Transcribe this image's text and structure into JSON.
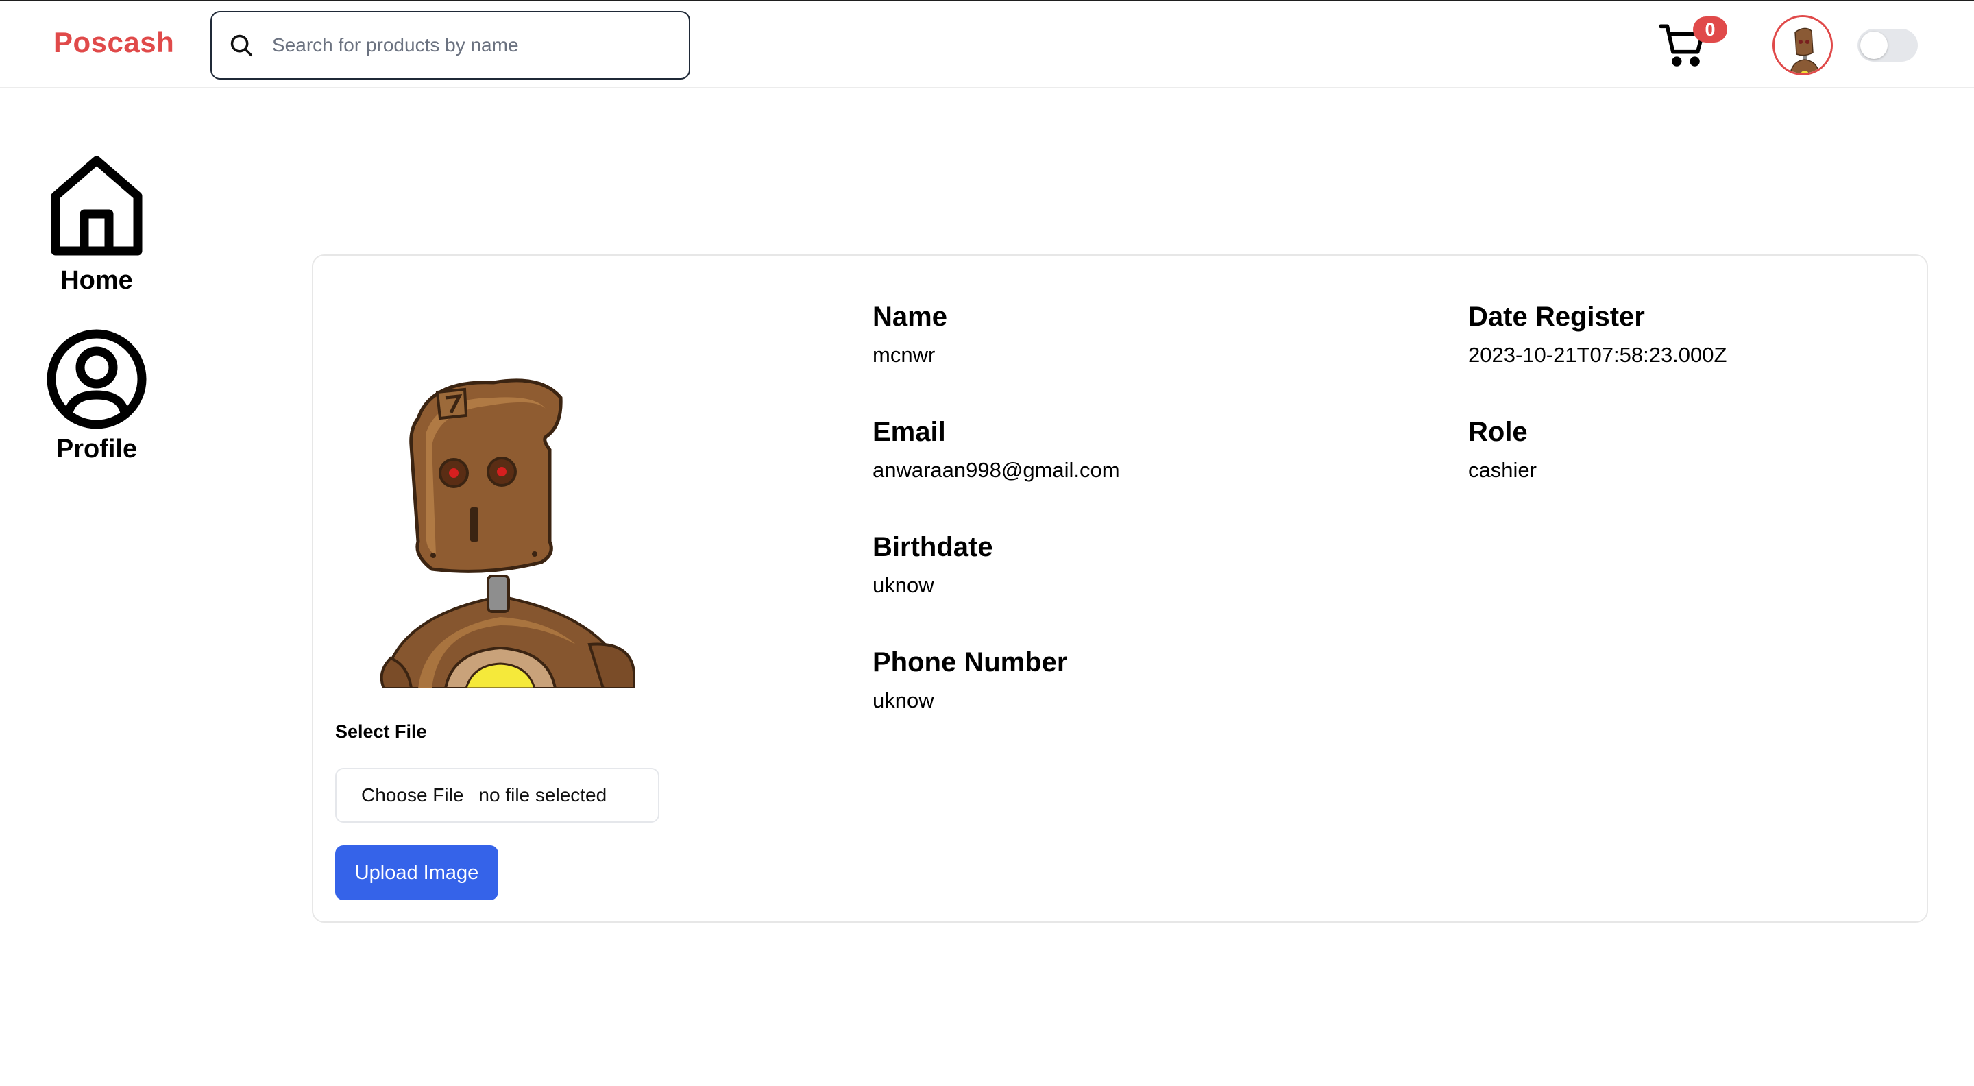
{
  "header": {
    "brand": "Poscash",
    "search_placeholder": "Search for products by name",
    "cart_count": "0",
    "brand_color": "#e04a4a",
    "icons": [
      "search-icon",
      "cart-icon",
      "avatar",
      "theme-toggle"
    ]
  },
  "sidebar": {
    "items": [
      {
        "label": "Home",
        "icon": "home-icon"
      },
      {
        "label": "Profile",
        "icon": "user-circle-icon"
      }
    ]
  },
  "profile": {
    "select_file_label": "Select File",
    "choose_file_label": "Choose File",
    "no_file_text": "no file selected",
    "upload_label": "Upload Image",
    "upload_color": "#3563e9",
    "fields": {
      "name": {
        "label": "Name",
        "value": "mcnwr"
      },
      "email": {
        "label": "Email",
        "value": "anwaraan998@gmail.com"
      },
      "birthdate": {
        "label": "Birthdate",
        "value": "uknow"
      },
      "phone": {
        "label": "Phone Number",
        "value": "uknow"
      },
      "date_register": {
        "label": "Date Register",
        "value": "2023-10-21T07:58:23.000Z"
      },
      "role": {
        "label": "Role",
        "value": "cashier"
      }
    }
  }
}
